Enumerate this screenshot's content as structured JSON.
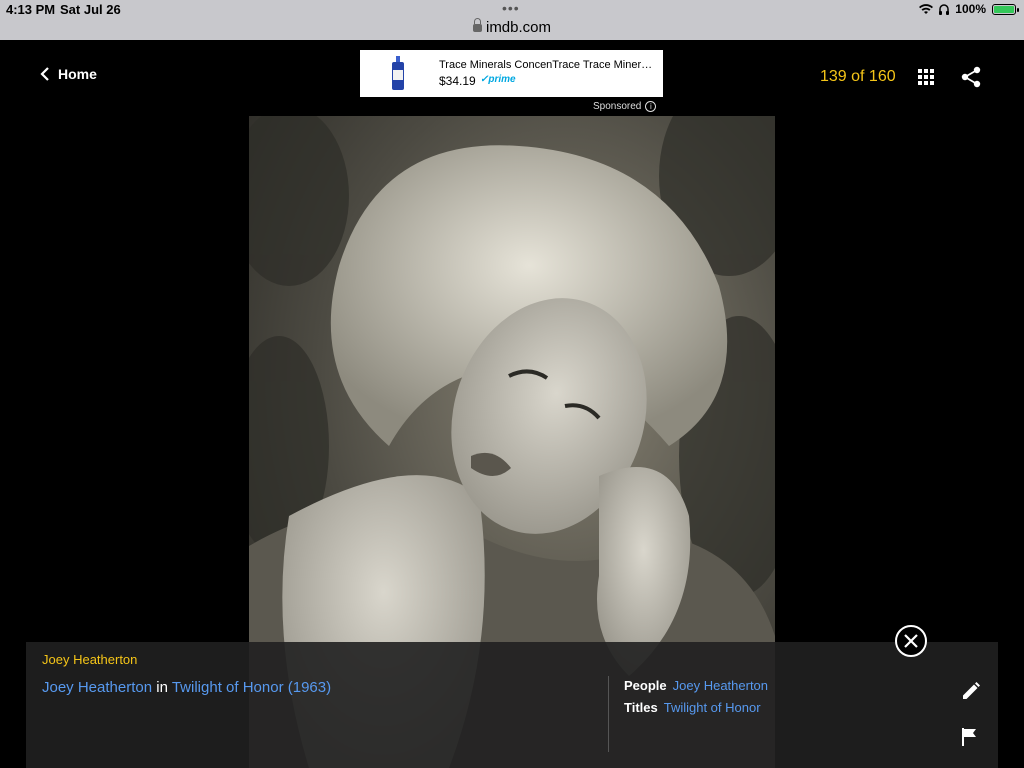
{
  "status_bar": {
    "time": "4:13 PM",
    "date": "Sat Jul 26",
    "battery": "100%",
    "battery_level": 1.0,
    "url": "imdb.com"
  },
  "nav": {
    "back_label": "Home",
    "counter": "139 of 160"
  },
  "ad": {
    "title": "Trace Minerals ConcenTrace Trace Mineral...",
    "price": "$34.19",
    "badge": "prime",
    "sponsored_label": "Sponsored"
  },
  "caption": {
    "name": "Joey Heatherton",
    "person_link": "Joey Heatherton",
    "connector": "in",
    "title_link": "Twilight of Honor (1963)",
    "people_label": "People",
    "people_value": "Joey Heatherton",
    "titles_label": "Titles",
    "titles_value": "Twilight of Honor"
  },
  "colors": {
    "accent": "#f5c518",
    "link": "#5799ef",
    "background": "#000000"
  },
  "icons": [
    "chevron-left-icon",
    "grid-icon",
    "share-icon",
    "close-icon",
    "edit-icon",
    "flag-icon",
    "lock-icon",
    "info-icon"
  ]
}
